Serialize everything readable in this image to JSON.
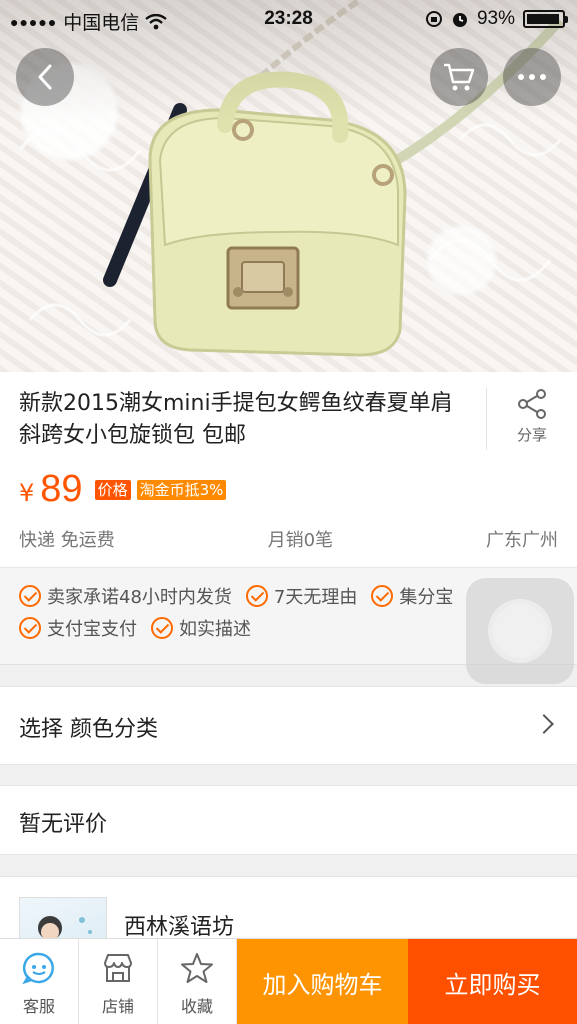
{
  "status_bar": {
    "signal_dots": "●●●●●",
    "carrier": "中国电信",
    "time": "23:28",
    "battery_percent": "93%",
    "battery_level": 0.93
  },
  "product": {
    "title": "新款2015潮女mini手提包女鳄鱼纹春夏单肩斜跨女小包旋锁包 包邮",
    "share_label": "分享",
    "currency": "¥",
    "price": "89",
    "price_tag": "价格",
    "coin_tag": "淘金币抵3%",
    "shipping": "快递 免运费",
    "monthly_sales": "月销0笔",
    "location": "广东广州"
  },
  "guarantees": [
    [
      "卖家承诺48小时内发货",
      "7天无理由",
      "集分宝"
    ],
    [
      "支付宝支付",
      "如实描述"
    ]
  ],
  "select_option": {
    "label": "选择 颜色分类"
  },
  "reviews": {
    "label": "暂无评价"
  },
  "shop": {
    "name": "西林溪语坊"
  },
  "bottom_bar": {
    "service_label": "客服",
    "store_label": "店铺",
    "favorite_label": "收藏",
    "add_to_cart_label": "加入购物车",
    "buy_now_label": "立即购买"
  },
  "colors": {
    "accent_orange": "#ff5500",
    "cart_button": "#ff9402",
    "buy_button": "#ff5000",
    "service_icon_blue": "#3aa8e8"
  }
}
